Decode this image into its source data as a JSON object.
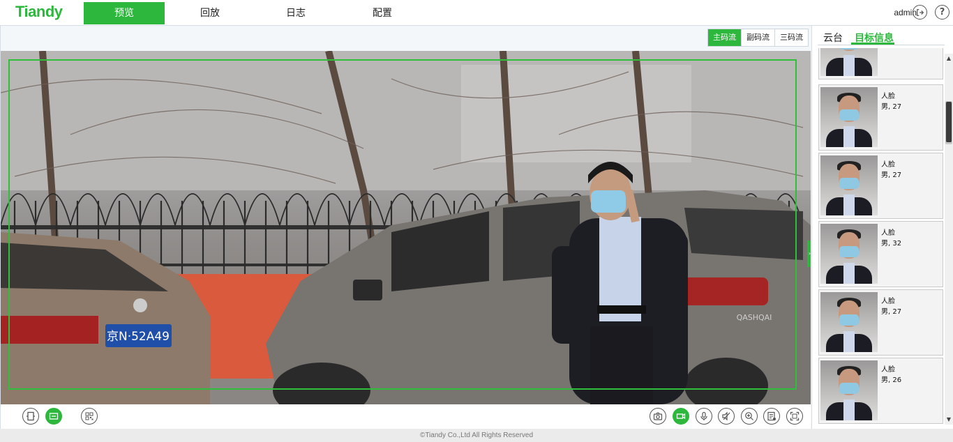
{
  "brand": {
    "logo_text": "Tiandy",
    "accent_color": "#2db83d"
  },
  "nav": {
    "tabs": [
      {
        "label": "预览",
        "active": true
      },
      {
        "label": "回放",
        "active": false
      },
      {
        "label": "日志",
        "active": false
      },
      {
        "label": "配置",
        "active": false
      }
    ],
    "user": "admin",
    "logout_icon": "logout-icon",
    "help_icon": "help-icon",
    "help_glyph": "?"
  },
  "stream": {
    "tabs": [
      {
        "label": "主码流",
        "active": true
      },
      {
        "label": "副码流",
        "active": false
      },
      {
        "label": "三码流",
        "active": false
      }
    ]
  },
  "video": {
    "license_plate": "京N·52A49",
    "car_brand_text": "QASHQAI",
    "detection_box_color": "#2fbf3a"
  },
  "controls": {
    "left": [
      {
        "icon": "window-split-icon",
        "active": false
      },
      {
        "icon": "aspect-fit-icon",
        "active": true
      },
      {
        "icon": "qr-code-icon",
        "active": false
      }
    ],
    "right": [
      {
        "icon": "snapshot-camera-icon",
        "active": false
      },
      {
        "icon": "record-video-icon",
        "active": true
      },
      {
        "icon": "microphone-icon",
        "active": false
      },
      {
        "icon": "speaker-mute-icon",
        "active": false
      },
      {
        "icon": "zoom-in-icon",
        "active": false
      },
      {
        "icon": "target-info-icon",
        "active": false
      },
      {
        "icon": "fullscreen-icon",
        "active": false
      }
    ]
  },
  "panel": {
    "tabs": [
      {
        "label": "云台",
        "active": false
      },
      {
        "label": "目标信息",
        "active": true
      }
    ],
    "cards": [
      {
        "type": "",
        "attrs": ""
      },
      {
        "type": "人脸",
        "attrs": "男, 27"
      },
      {
        "type": "人脸",
        "attrs": "男, 27"
      },
      {
        "type": "人脸",
        "attrs": "男, 32"
      },
      {
        "type": "人脸",
        "attrs": "男, 27"
      },
      {
        "type": "人脸",
        "attrs": "男, 26"
      }
    ]
  },
  "footer": {
    "copyright": "©Tiandy Co.,Ltd All Rights Reserved"
  }
}
